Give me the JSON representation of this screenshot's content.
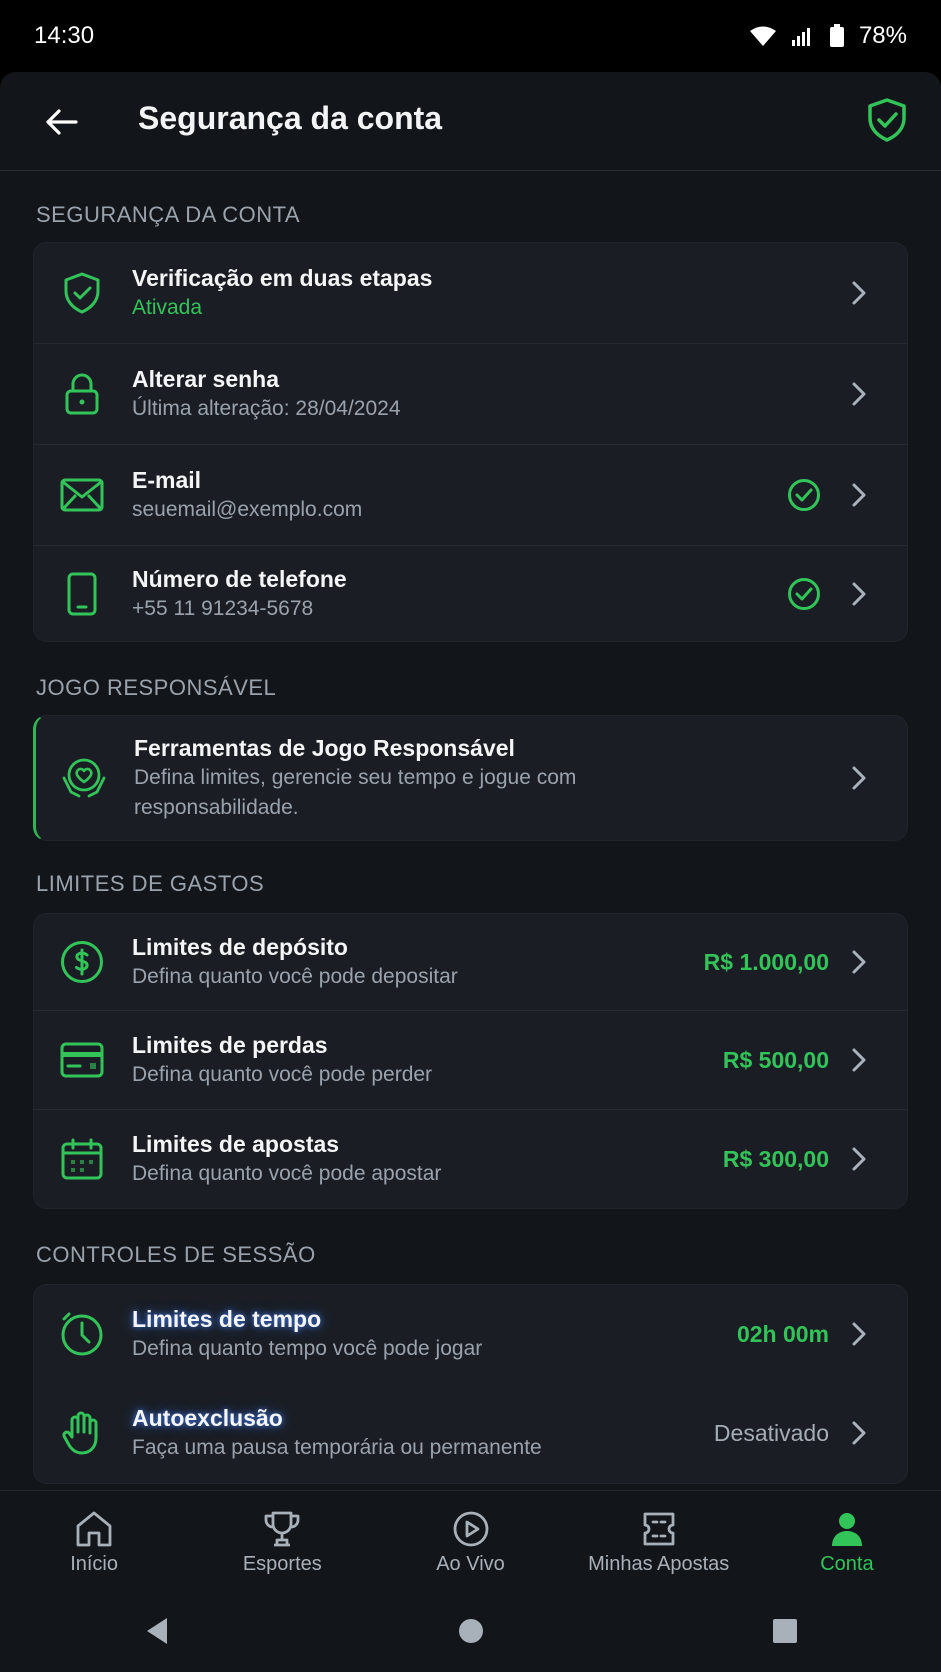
{
  "status": {
    "time": "14:30",
    "battery": "78%"
  },
  "header": {
    "title": "Segurança da conta"
  },
  "sections": {
    "security": {
      "title": "SEGURANÇA DA CONTA",
      "items": [
        {
          "title": "Verificação em duas etapas",
          "subtitle": "Ativada"
        },
        {
          "title": "Alterar senha",
          "subtitle": "Última alteração: 28/04/2024"
        },
        {
          "title": "E-mail",
          "subtitle": "seuemail@exemplo.com"
        },
        {
          "title": "Número de telefone",
          "subtitle": "+55 11 91234-5678"
        }
      ]
    },
    "responsible": {
      "title": "JOGO RESPONSÁVEL",
      "items": [
        {
          "title": "Ferramentas de Jogo Responsável",
          "subtitle": "Defina limites, gerencie seu tempo e jogue com responsabilidade."
        }
      ]
    },
    "limits": {
      "title": "LIMITES DE GASTOS",
      "items": [
        {
          "title": "Limites de depósito",
          "subtitle": "Defina quanto você pode depositar",
          "value": "R$ 1.000,00"
        },
        {
          "title": "Limites de perdas",
          "subtitle": "Defina quanto você pode perder",
          "value": "R$ 500,00"
        },
        {
          "title": "Limites de apostas",
          "subtitle": "Defina quanto você pode apostar",
          "value": "R$ 300,00"
        }
      ]
    },
    "session": {
      "title": "CONTROLES DE SESSÃO",
      "items": [
        {
          "title": "Limites de tempo",
          "subtitle": "Defina quanto tempo você pode jogar",
          "value": "02h 00m"
        },
        {
          "title": "Autoexclusão",
          "subtitle": "Faça uma pausa temporária ou permanente",
          "value": "Desativado"
        }
      ]
    }
  },
  "nav": {
    "items": [
      {
        "label": "Início",
        "icon": "home-icon"
      },
      {
        "label": "Esportes",
        "icon": "trophy-icon"
      },
      {
        "label": "Ao Vivo",
        "icon": "play-circle-icon"
      },
      {
        "label": "Minhas Apostas",
        "icon": "ticket-icon"
      },
      {
        "label": "Conta",
        "icon": "user-icon",
        "active": true
      }
    ]
  },
  "colors": {
    "accent": "#32c459",
    "background": "#121519",
    "card": "#1a1e24"
  }
}
